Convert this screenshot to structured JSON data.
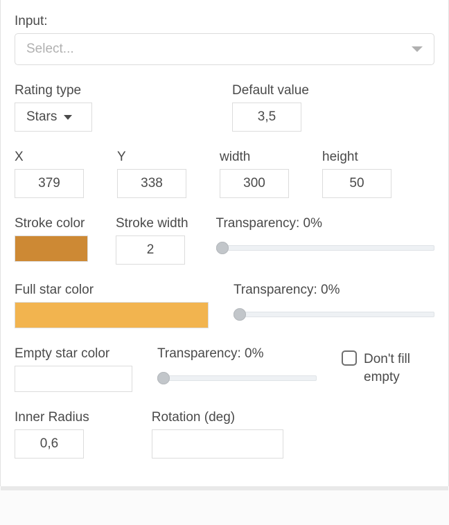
{
  "input": {
    "label": "Input:",
    "placeholder": "Select..."
  },
  "rating_type": {
    "label": "Rating type",
    "value": "Stars"
  },
  "default_value": {
    "label": "Default value",
    "value": "3,5"
  },
  "x": {
    "label": "X",
    "value": "379"
  },
  "y": {
    "label": "Y",
    "value": "338"
  },
  "width": {
    "label": "width",
    "value": "300"
  },
  "height": {
    "label": "height",
    "value": "50"
  },
  "stroke_color": {
    "label": "Stroke color",
    "value": "#cd8934"
  },
  "stroke_width": {
    "label": "Stroke width",
    "value": "2"
  },
  "full_color": {
    "label": "Full star color",
    "value": "#f2b44f"
  },
  "empty_color": {
    "label": "Empty star color",
    "value": "#ffffff"
  },
  "transparency1": {
    "label": "Transparency: 0%",
    "percent": 0
  },
  "transparency2": {
    "label": "Transparency: 0%",
    "percent": 0
  },
  "transparency3": {
    "label": "Transparency: 0%",
    "percent": 0
  },
  "dont_fill": {
    "label": "Don't fill empty",
    "checked": false
  },
  "inner_radius": {
    "label": "Inner Radius",
    "value": "0,6"
  },
  "rotation": {
    "label": "Rotation (deg)",
    "value": ""
  }
}
